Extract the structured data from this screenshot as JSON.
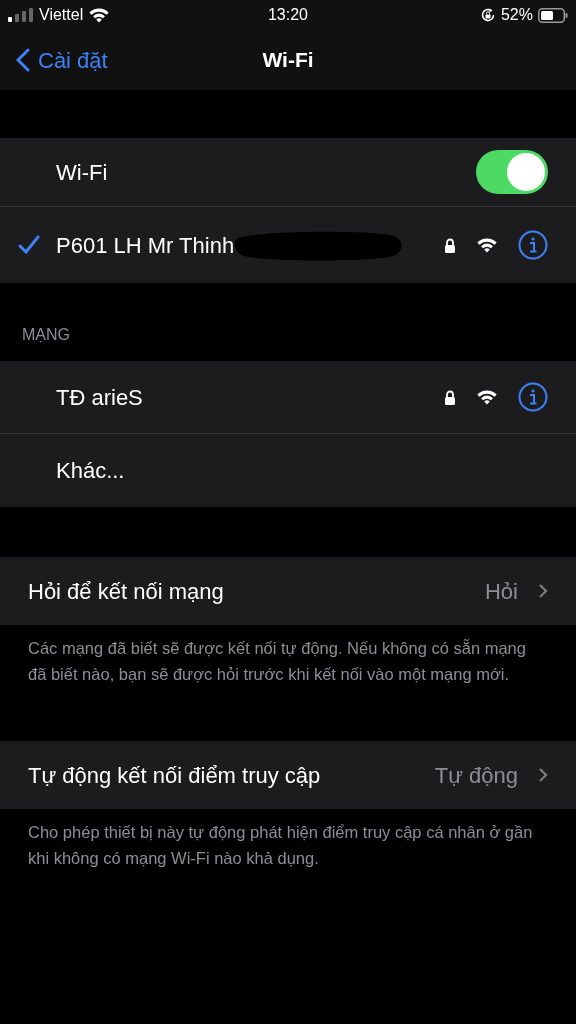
{
  "status_bar": {
    "carrier": "Viettel",
    "time": "13:20",
    "battery": "52%"
  },
  "nav": {
    "back": "Cài đặt",
    "title": "Wi-Fi"
  },
  "wifi": {
    "label": "Wi-Fi",
    "on": true
  },
  "current_network": {
    "name": "P601 LH Mr Thinh",
    "selected": true,
    "locked": true,
    "redacted": true
  },
  "networks_header": "MẠNG",
  "networks": [
    {
      "kind": "network",
      "name": "TĐ arieS",
      "locked": true
    },
    {
      "kind": "other",
      "name": "Khác..."
    }
  ],
  "settings": [
    {
      "label": "Hỏi để kết nối mạng",
      "value": "Hỏi",
      "footnote": "Các mạng đã biết sẽ được kết nối tự động. Nếu không có sẵn mạng đã biết nào, bạn sẽ được hỏi trước khi kết nối vào một mạng mới."
    },
    {
      "label": "Tự động kết nối điểm truy cập",
      "value": "Tự động",
      "footnote": "Cho phép thiết bị này tự động phát hiện điểm truy cập cá nhân ở gần khi không có mạng Wi-Fi nào khả dụng."
    }
  ]
}
